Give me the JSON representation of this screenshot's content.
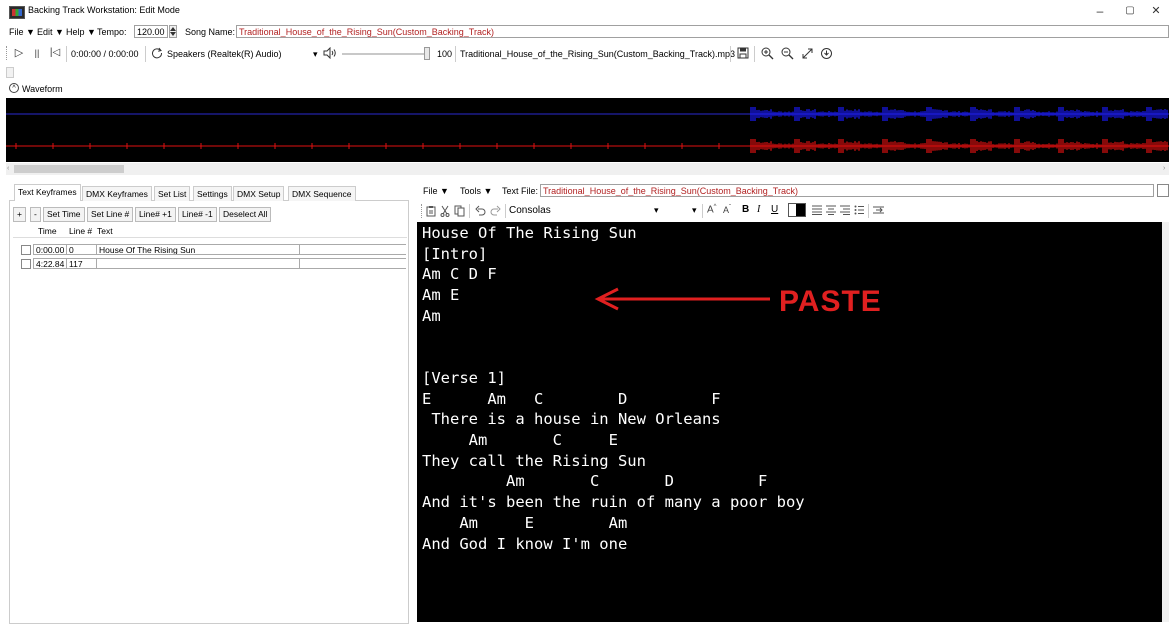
{
  "window": {
    "title": "Backing Track Workstation: Edit Mode",
    "minimize": "–",
    "maximize": "▢",
    "close": "✕"
  },
  "menubar": {
    "file": "File ▼",
    "edit": "Edit ▼",
    "help": "Help ▼",
    "tempo_label": "Tempo:",
    "tempo_value": "120.00",
    "song_name_label": "Song Name:",
    "song_name_value": "Traditional_House_of_the_Rising_Sun(Custom_Backing_Track)"
  },
  "transport": {
    "play": "▷",
    "pause": "||",
    "rewind": "|◁",
    "time": "0:00:00 / 0:00:00",
    "device_icon": "refresh-icon",
    "device": "Speakers (Realtek(R) Audio)",
    "device_arrow": "▾",
    "volume_icon": "speaker-icon",
    "volume_value": "100",
    "file_name": "Traditional_House_of_the_Rising_Sun(Custom_Backing_Track).mp3"
  },
  "waveform": {
    "toggle": "^",
    "label": "Waveform",
    "colors": {
      "top": "#1a1aff",
      "bottom": "#e01010",
      "line_top": "#2a2ad0",
      "line_bottom": "#c01010"
    }
  },
  "left_tabs": [
    "Text Keyframes",
    "DMX Keyframes",
    "Set List",
    "Settings",
    "DMX Setup",
    "DMX Sequence"
  ],
  "keyframe_buttons": [
    "+",
    "-",
    "Set Time",
    "Set Line #",
    "Line# +1",
    "Line# -1",
    "Deselect All"
  ],
  "grid": {
    "headers": [
      "Time",
      "Line #",
      "Text"
    ],
    "rows": [
      {
        "time": "0:00.00",
        "line": "0",
        "text": "House Of The Rising Sun"
      },
      {
        "time": "4:22.84",
        "line": "117",
        "text": ""
      }
    ]
  },
  "right_menu": {
    "file": "File ▼",
    "tools": "Tools ▼",
    "text_file_label": "Text File:",
    "text_file_value": "Traditional_House_of_the_Rising_Sun(Custom_Backing_Track)"
  },
  "format_toolbar": {
    "font_name": "Consolas",
    "font_arrow": "▾",
    "size_arrow": "▾",
    "bold": "B",
    "italic": "I",
    "underline": "U"
  },
  "editor_lines": [
    "House Of The Rising Sun",
    "[Intro]",
    "Am C D F",
    "Am E",
    "Am",
    "",
    "",
    "[Verse 1]",
    "E      Am   C        D         F",
    " There is a house in New Orleans",
    "     Am       C     E",
    "They call the Rising Sun",
    "         Am       C       D         F",
    "And it's been the ruin of many a poor boy",
    "    Am     E        Am",
    "And God I know I'm one"
  ],
  "annotation": {
    "text": "PASTE",
    "color": "#e02020"
  }
}
